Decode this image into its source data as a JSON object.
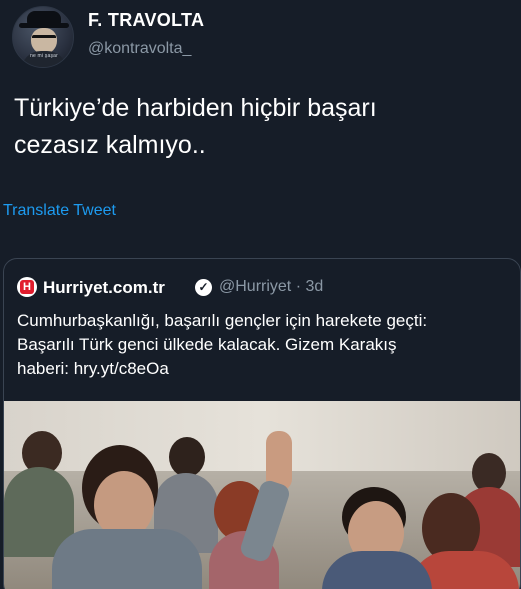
{
  "author": {
    "display_name": "F. TRAVOLTA",
    "handle": "@kontravolta_",
    "avatar_caption": "ne mi şaşar"
  },
  "tweet": {
    "text_line1": "Türkiye’de harbiden hiçbir başarı",
    "text_line2": "cezasız kalmıyo..",
    "translate_label": "Translate Tweet"
  },
  "quote": {
    "logo_letter": "H",
    "name": "Hurriyet.com.tr",
    "verified_glyph": "✓",
    "handle_time": "@Hurriyet · 3d",
    "line1": "Cumhurbaşkanlığı, başarılı gençler için harekete geçti:",
    "line2": "Başarılı Türk genci ülkede kalacak. Gizem Karakış",
    "line3": "haberi: hry.yt/c8eOa"
  },
  "colors": {
    "background": "#161d28",
    "link": "#1d9bf0",
    "secondary_text": "#8b98a5",
    "brand_red": "#e11d2e"
  },
  "icons": [
    "avatar-image",
    "hurriyet-logo-icon",
    "verified-badge-icon"
  ]
}
